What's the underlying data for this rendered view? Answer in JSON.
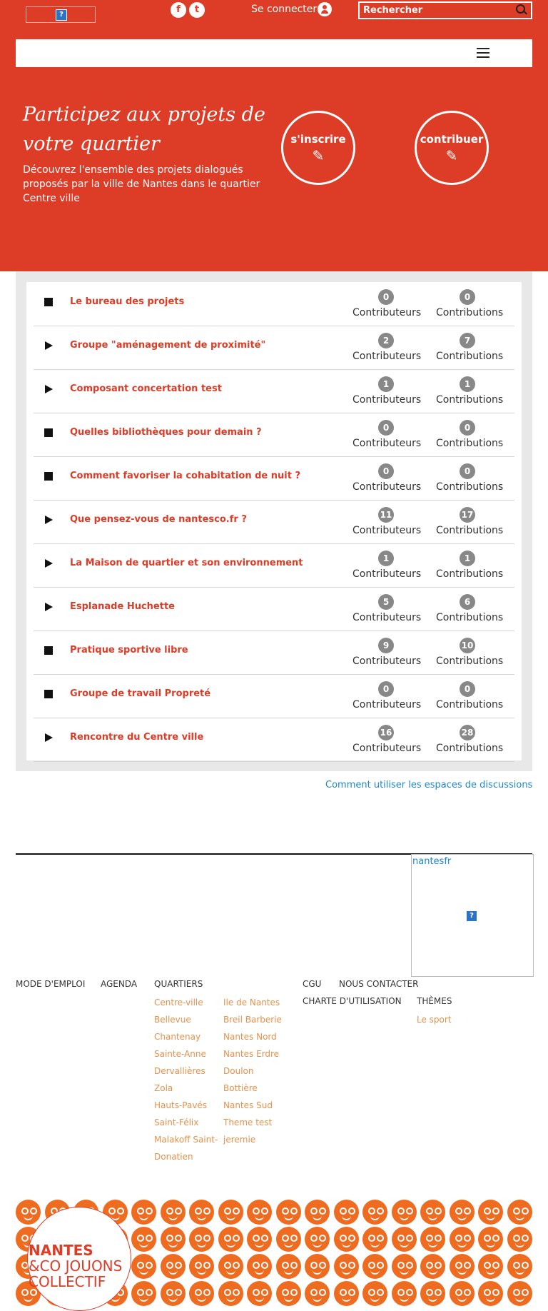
{
  "header": {
    "facebook_glyph": "f",
    "twitter_glyph": "t",
    "connect_label": "Se connecter",
    "search_placeholder": "Rechercher",
    "broken_image_glyph": "?",
    "accent_color": "#dd3c27"
  },
  "hero": {
    "title": "Participez aux projets de votre quartier",
    "subtitle": "Découvrez l'ensemble des projets dialogués proposés par la ville de Nantes dans le quartier Centre ville",
    "signup_label": "s'inscrire",
    "contribute_label": "contribuer",
    "pencil_glyph": "✎"
  },
  "projects": {
    "contributors_label": "Contributeurs",
    "contributions_label": "Contributions",
    "items": [
      {
        "status": "closed",
        "title": "Le bureau des projets",
        "contributors": "0",
        "contributions": "0"
      },
      {
        "status": "open",
        "title": "Groupe \"aménagement de proximité\"",
        "contributors": "2",
        "contributions": "7"
      },
      {
        "status": "open",
        "title": "Composant concertation test",
        "contributors": "1",
        "contributions": "1"
      },
      {
        "status": "closed",
        "title": "Quelles bibliothèques pour demain ?",
        "contributors": "0",
        "contributions": "0"
      },
      {
        "status": "closed",
        "title": "Comment favoriser la cohabitation de nuit ?",
        "contributors": "0",
        "contributions": "0"
      },
      {
        "status": "open",
        "title": "Que pensez-vous de nantesco.fr ?",
        "contributors": "11",
        "contributions": "17"
      },
      {
        "status": "open",
        "title": "La Maison de quartier et son environnement",
        "contributors": "1",
        "contributions": "1"
      },
      {
        "status": "open",
        "title": "Esplanade Huchette",
        "contributors": "5",
        "contributions": "6"
      },
      {
        "status": "closed",
        "title": "Pratique sportive libre",
        "contributors": "9",
        "contributions": "10"
      },
      {
        "status": "closed",
        "title": "Groupe de travail Propreté",
        "contributors": "0",
        "contributions": "0"
      },
      {
        "status": "open",
        "title": "Rencontre du Centre ville",
        "contributors": "16",
        "contributions": "28"
      }
    ]
  },
  "help_link": "Comment utiliser les espaces de discussions",
  "widget": {
    "link": "nantesfr",
    "broken_image_glyph": "?"
  },
  "footer": {
    "mode_emploi": "Mode d'emploi",
    "agenda": "Agenda",
    "quartiers": "Quartiers",
    "quartiers_col1": [
      "Centre-ville",
      "Bellevue",
      "Chantenay",
      "Sainte-Anne",
      "Dervallières",
      "Zola",
      "Hauts-Pavés",
      "Saint-Félix",
      "Malakoff Saint-",
      "Donatien"
    ],
    "quartiers_col2": [
      "Ile de Nantes",
      "Breil Barberie",
      "Nantes Nord",
      "Nantes Erdre",
      "Doulon",
      "Bottière",
      "Nantes Sud",
      "Theme test",
      "jeremie"
    ],
    "cgu": "CGU",
    "contact": "Nous contacter",
    "charte": "Charte d'utilisation",
    "themes": "Thèmes",
    "themes_items": [
      "Le sport"
    ]
  },
  "brand": {
    "line1": "NANTES",
    "line2": "&CO JOUONS",
    "line3": "COLLECTIF",
    "face_color": "#ef6b1f"
  }
}
